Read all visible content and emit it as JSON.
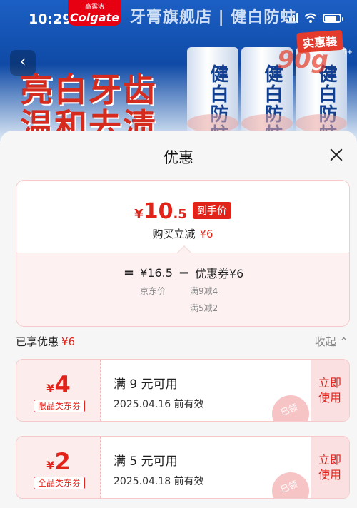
{
  "status_bar": {
    "time": "10:29"
  },
  "background": {
    "brand_cn": "高露洁",
    "brand_en": "Colgate",
    "store_title": "牙膏旗舰店 | 健白防蛀",
    "promo_tag": "实惠装",
    "promo_weight": "90g",
    "promo_count": "5+",
    "slogan_line1": "亮白牙齿",
    "slogan_line2": "温和去渍",
    "tube_label": "健白防蛀"
  },
  "sheet": {
    "title": "优惠",
    "summary": {
      "currency": "¥",
      "price_int": "10",
      "price_dec": ".5",
      "price_tag": "到手价",
      "discount_label": "购买立减",
      "discount_amount": "¥6",
      "equals": "=",
      "jd_price": "¥16.5",
      "minus": "−",
      "coupon_label": "优惠券¥6",
      "jd_price_label": "京东价",
      "coupon_detail_1": "满9减4",
      "coupon_detail_2": "满5减2"
    },
    "enjoyed": {
      "label": "已享优惠",
      "amount": "¥6",
      "collapse": "收起",
      "collapse_icon": "chevron-up-icon"
    },
    "coupons": [
      {
        "currency": "¥",
        "value": "4",
        "type": "限品类东券",
        "condition": "满 9 元可用",
        "validity": "2025.04.16 前有效",
        "action": "立即使用",
        "stamp": "已领"
      },
      {
        "currency": "¥",
        "value": "2",
        "type": "全品类东券",
        "condition": "满 5 元可用",
        "validity": "2025.04.18 前有效",
        "action": "立即使用",
        "stamp": "已领"
      }
    ]
  },
  "colors": {
    "accent_red": "#e2231a",
    "sheet_bg": "#f6f6f6"
  }
}
